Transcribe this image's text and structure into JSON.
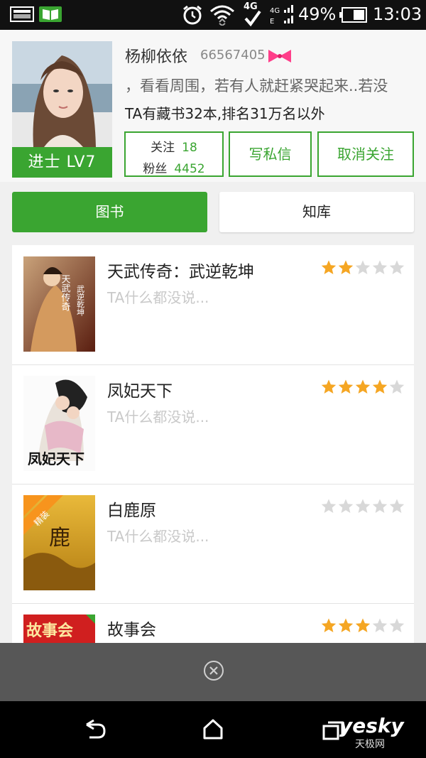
{
  "status_bar": {
    "network": "4G",
    "battery": "49%",
    "time": "13:03"
  },
  "profile": {
    "username": "杨柳依依",
    "user_id": "66567405",
    "level": "进士 LV7",
    "signature": "，看看周围，若有人就赶紧哭起来..若没",
    "book_info": "TA有藏书32本,排名31万名以外",
    "follow_label": "关注",
    "follow_count": "18",
    "fans_label": "粉丝",
    "fans_count": "4452",
    "message_button": "写私信",
    "unfollow_button": "取消关注"
  },
  "tabs": {
    "books": "图书",
    "library": "知库"
  },
  "books": [
    {
      "title": "天武传奇：武逆乾坤",
      "comment": "TA什么都没说...",
      "rating": 2
    },
    {
      "title": "凤妃天下",
      "comment": "TA什么都没说...",
      "rating": 4
    },
    {
      "title": "白鹿原",
      "comment": "TA什么都没说...",
      "rating": 0
    },
    {
      "title": "故事会",
      "comment": "",
      "rating": 3
    }
  ],
  "covers": {
    "book1_text": "天武传奇",
    "book1_sub": "武逆乾坤",
    "book2_text": "凤妃天下",
    "book3_badge": "精装",
    "book3_text": "鹿",
    "book4_text": "故事会"
  },
  "watermark": {
    "logo": "yesky",
    "sub": "天极网"
  },
  "colors": {
    "accent": "#3aa531",
    "star_on": "#f5a623",
    "star_off": "#d8d8d8"
  }
}
